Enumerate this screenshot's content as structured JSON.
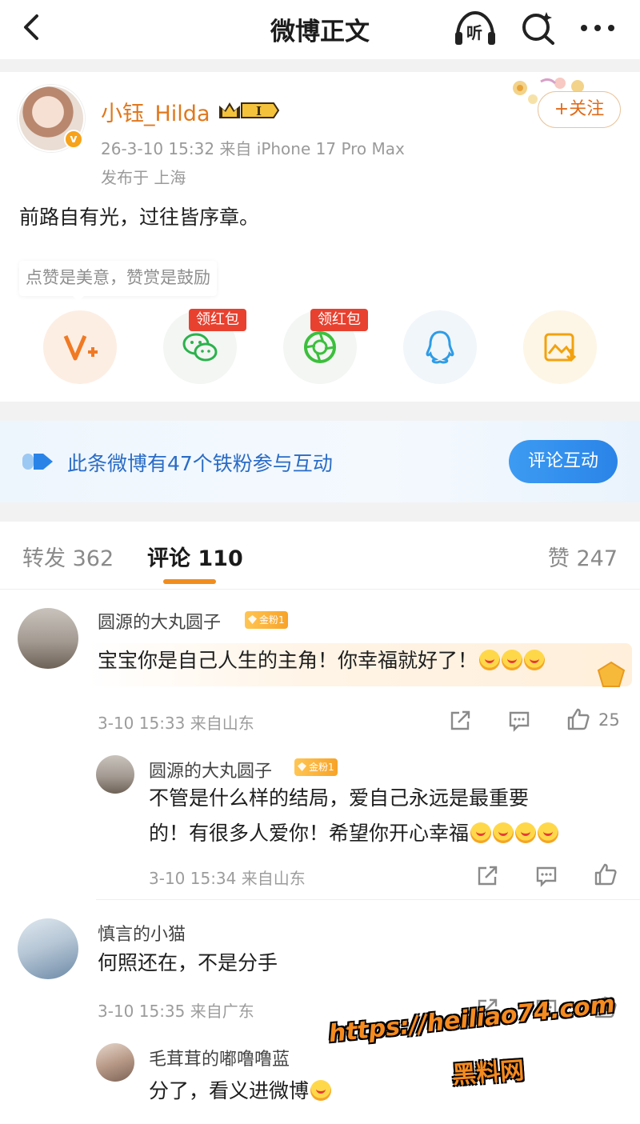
{
  "header": {
    "title": "微博正文",
    "listen_label": "听",
    "icons": [
      "back-icon",
      "listen-icon",
      "search-ai-icon",
      "more-icon"
    ]
  },
  "post": {
    "username": "小钰_Hilda",
    "vip_level": "I",
    "meta": "26-3-10 15:32 来自 iPhone 17 Pro Max",
    "location": "发布于 上海",
    "follow_label": "+关注",
    "text": "前路自有光，过往皆序章。",
    "reward_tip": "点赞是美意，赞赏是鼓励",
    "share_options": [
      {
        "icon": "reward-v-icon",
        "tag": ""
      },
      {
        "icon": "wechat-icon",
        "tag": "领红包"
      },
      {
        "icon": "moments-icon",
        "tag": "领红包"
      },
      {
        "icon": "qq-icon",
        "tag": ""
      },
      {
        "icon": "save-image-icon",
        "tag": ""
      }
    ]
  },
  "fans_banner": {
    "text": "此条微博有47个铁粉参与互动",
    "button": "评论互动"
  },
  "tabs": {
    "repost": "转发 362",
    "comment": "评论 110",
    "like": "赞 247"
  },
  "comments": [
    {
      "name": "圆源的大丸圆子",
      "badge": "金粉1",
      "text": "宝宝你是自己人生的主角！你幸福就好了！",
      "time": "3-10 15:33 来自山东",
      "likes": "25"
    },
    {
      "name": "圆源的大丸圆子",
      "badge": "金粉1",
      "text_line1": "不管是什么样的结局，爱自己永远是最重要",
      "text_line2": "的！有很多人爱你！希望你开心幸福",
      "time": "3-10 15:34 来自山东"
    },
    {
      "name": "慎言的小猫",
      "text": "何照还在，不是分手",
      "time": "3-10 15:35 来自广东"
    },
    {
      "name": "毛茸茸的嘟噜噜蓝",
      "text": "分了，看义进微博"
    }
  ],
  "watermark": {
    "url": "https://heiliao74.com",
    "site": "黑料网"
  },
  "colors": {
    "accent_orange": "#e0781e",
    "link_blue": "#2a6cc6",
    "red_tag": "#e8412f"
  }
}
